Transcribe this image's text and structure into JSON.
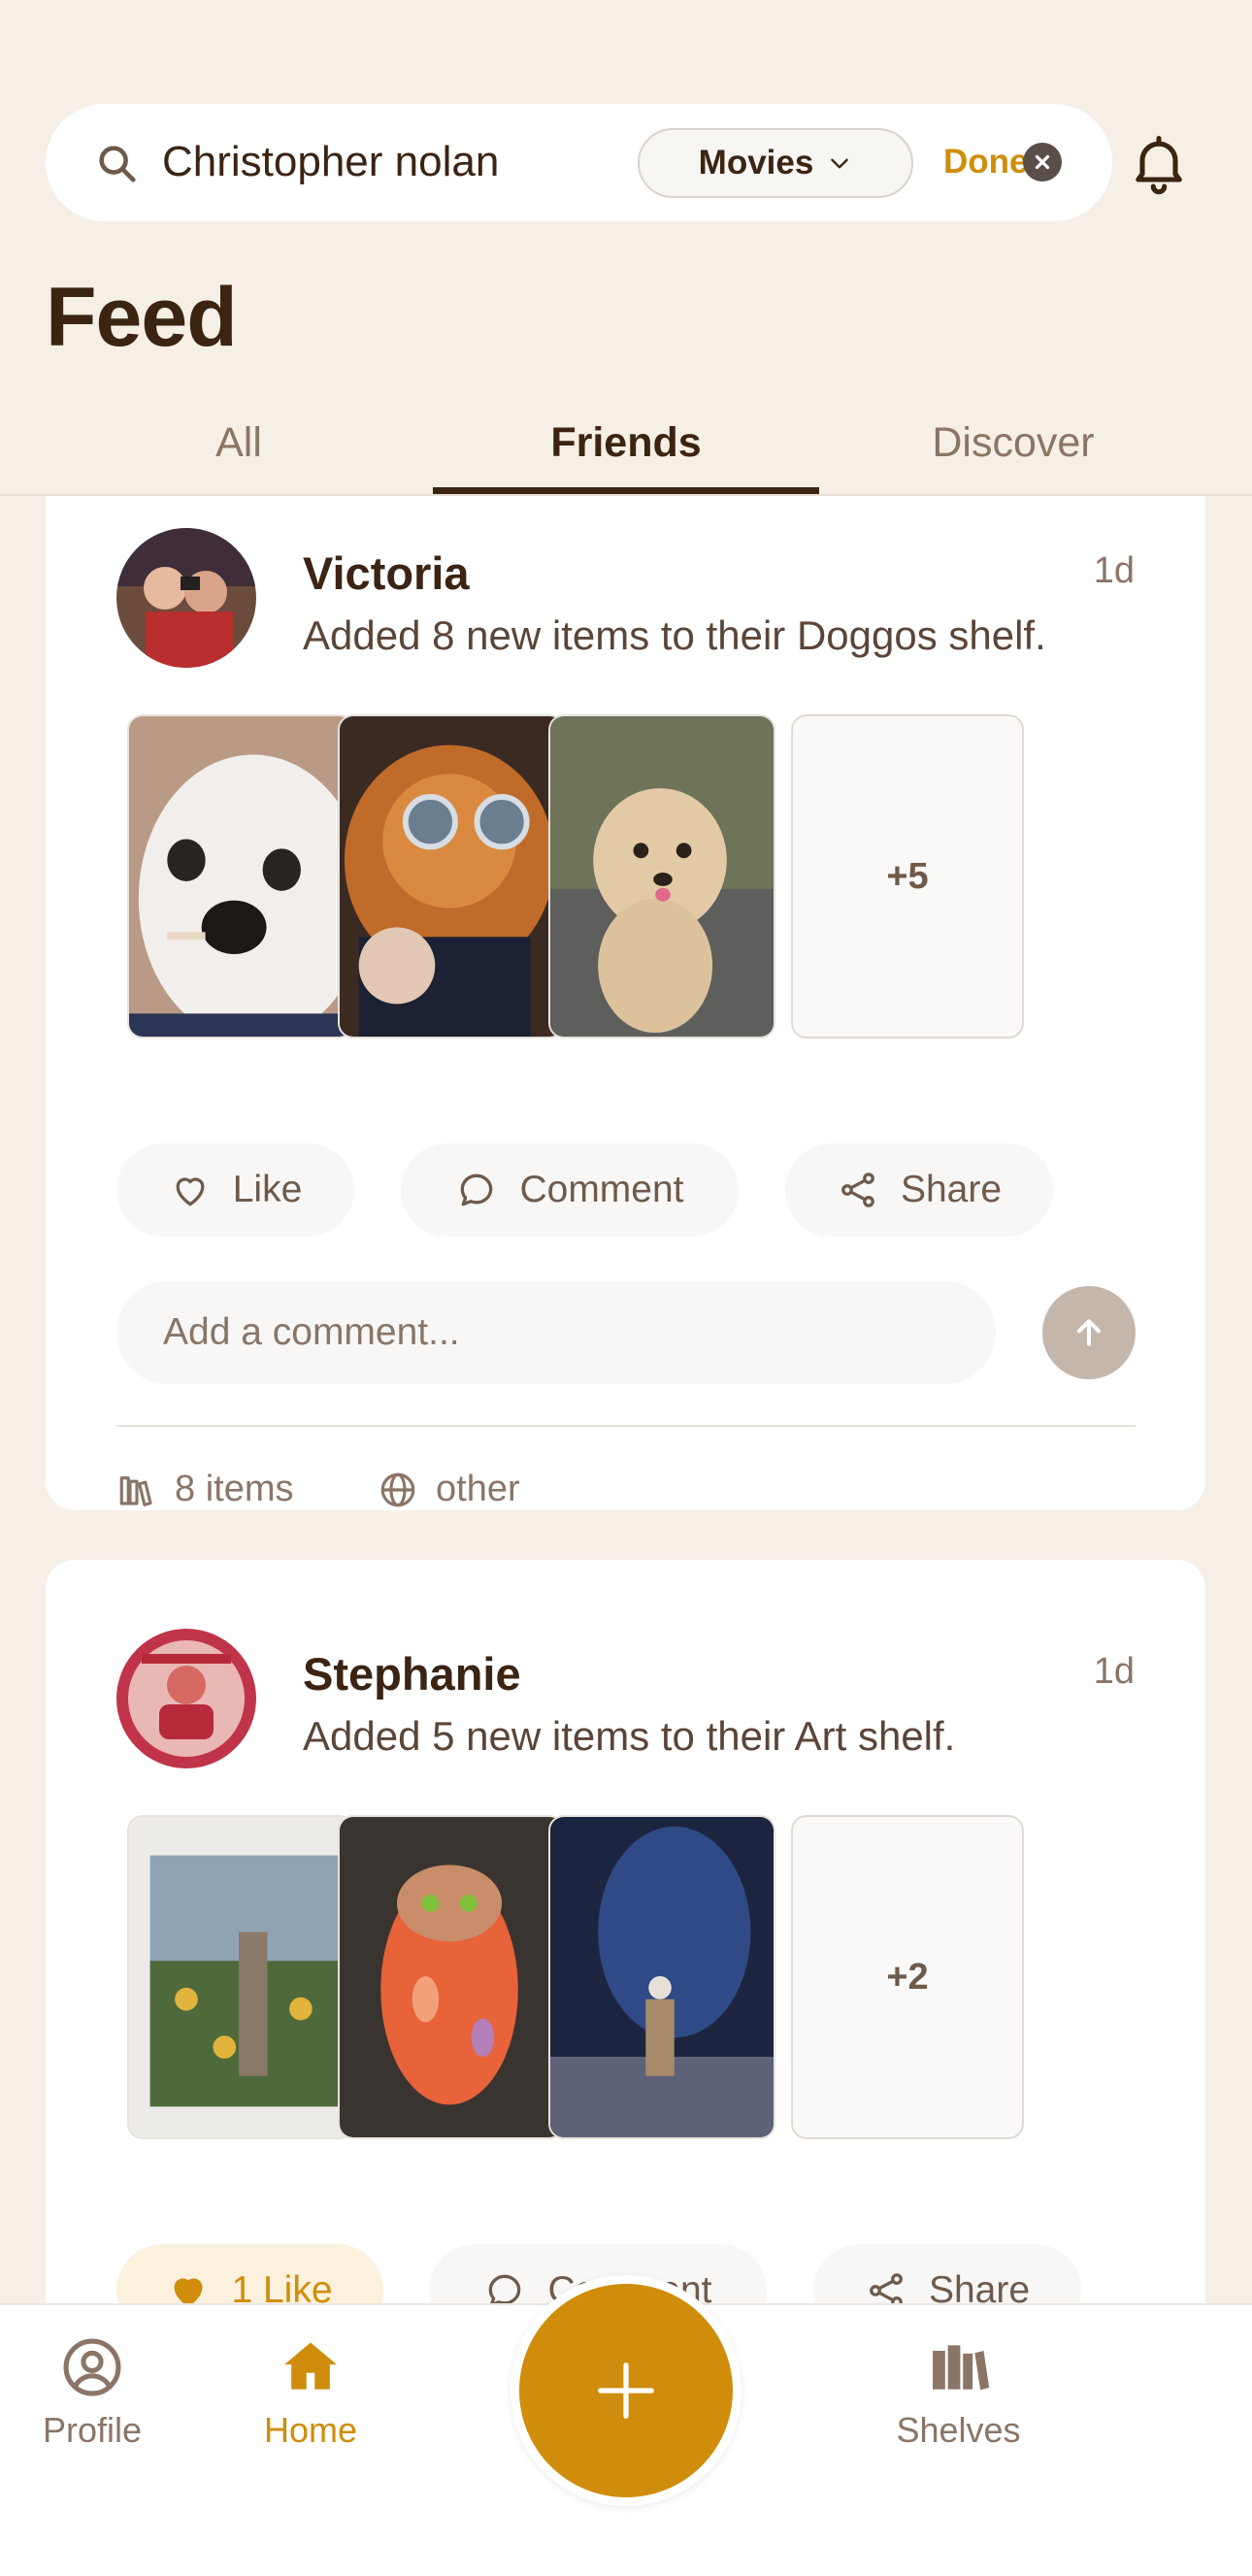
{
  "search": {
    "value": "Christopher nolan",
    "filter_label": "Movies",
    "done_label": "Done"
  },
  "header": {
    "title": "Feed",
    "tabs": [
      {
        "label": "All",
        "active": false
      },
      {
        "label": "Friends",
        "active": true
      },
      {
        "label": "Discover",
        "active": false
      }
    ]
  },
  "posts": [
    {
      "user": "Victoria",
      "time": "1d",
      "text": "Added 8 new items to their Doggos shelf.",
      "more_count": "+5",
      "actions": {
        "like": "Like",
        "comment": "Comment",
        "share": "Share"
      },
      "comment_placeholder": "Add a comment...",
      "meta_items": "8 items",
      "meta_visibility": "other"
    },
    {
      "user": "Stephanie",
      "time": "1d",
      "text": "Added 5 new items to their Art shelf.",
      "more_count": "+2",
      "actions": {
        "like": "1 Like",
        "comment": "Comment",
        "share": "Share"
      }
    }
  ],
  "nav": {
    "profile": "Profile",
    "home": "Home",
    "shelves": "Shelves"
  },
  "colors": {
    "background": "#f5efe6",
    "accent": "#cf8d0b",
    "text_primary": "#3b2412",
    "text_secondary": "#8a7566"
  }
}
